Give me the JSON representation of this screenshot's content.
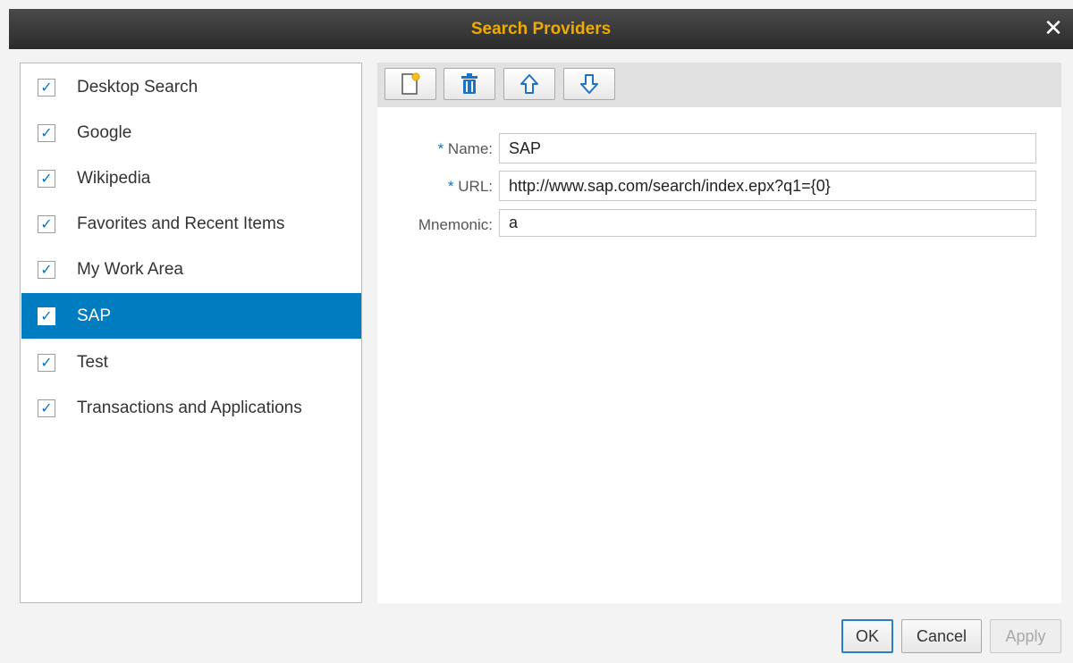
{
  "dialog": {
    "title": "Search Providers",
    "close_symbol": "✕"
  },
  "providers": [
    {
      "label": "Desktop Search",
      "checked": true
    },
    {
      "label": "Google",
      "checked": true
    },
    {
      "label": "Wikipedia",
      "checked": true
    },
    {
      "label": "Favorites and Recent Items",
      "checked": true
    },
    {
      "label": "My Work Area",
      "checked": true
    },
    {
      "label": "SAP",
      "checked": true,
      "selected": true
    },
    {
      "label": "Test",
      "checked": true
    },
    {
      "label": "Transactions and Applications",
      "checked": true
    }
  ],
  "checkmark": "✓",
  "toolbar": {
    "icons": [
      "new-document-icon",
      "trash-icon",
      "arrow-up-icon",
      "arrow-down-icon"
    ]
  },
  "form": {
    "required_marker": "*",
    "name_label": "Name:",
    "name_value": "SAP",
    "url_label": "URL:",
    "url_value": "http://www.sap.com/search/index.epx?q1={0}",
    "mnemonic_label": "Mnemonic:",
    "mnemonic_value": "a"
  },
  "buttons": {
    "ok": "OK",
    "cancel": "Cancel",
    "apply": "Apply"
  },
  "colors": {
    "title": "#f0ab00",
    "selection": "#007cc0",
    "check": "#0a75c2"
  }
}
